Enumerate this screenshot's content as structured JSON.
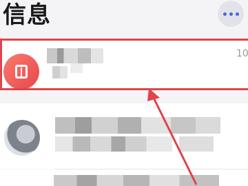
{
  "header": {
    "title": "信息",
    "more_icon": "more-horizontal-icon"
  },
  "messages": [
    {
      "name": "",
      "preview": "",
      "time": "10",
      "avatar_icon": "book-icon",
      "highlighted": true
    },
    {
      "name": "",
      "preview": "",
      "time": "",
      "avatar_icon": "person-avatar",
      "highlighted": false
    },
    {
      "name": "",
      "preview": "",
      "time": "",
      "avatar_icon": "",
      "highlighted": false
    }
  ],
  "annotation": {
    "highlight_color": "#e0444c",
    "arrow_color": "#e0444c"
  },
  "colors": {
    "accent": "#4a68d8",
    "avatar_red": "#e8474a"
  }
}
